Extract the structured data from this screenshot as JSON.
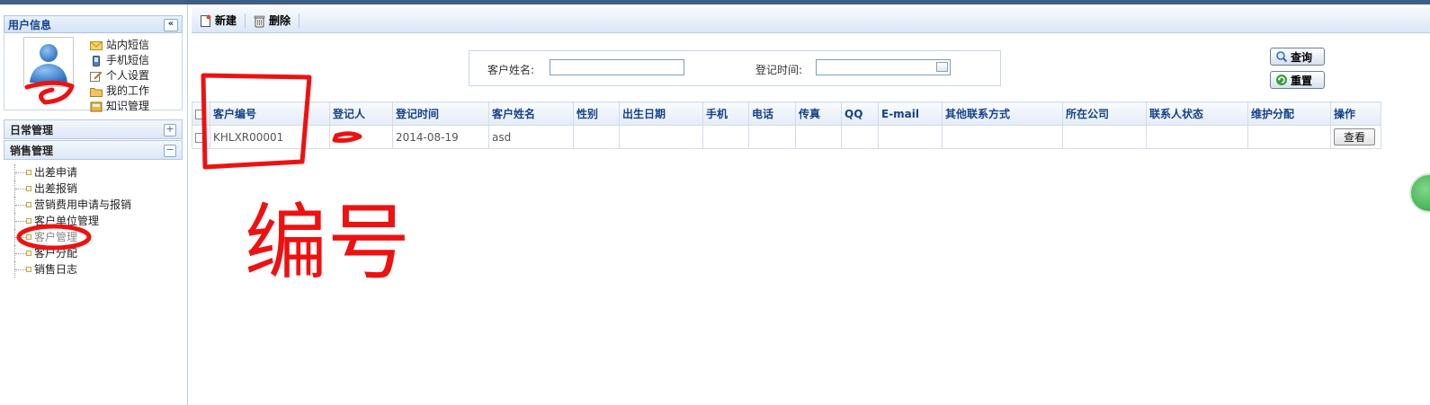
{
  "left": {
    "user_panel_title": "用户信息",
    "collapse_glyph": "«",
    "quick_links": [
      {
        "label": "站内短信",
        "icon": "envelope-icon"
      },
      {
        "label": "手机短信",
        "icon": "mobile-phone-icon"
      },
      {
        "label": "个人设置",
        "icon": "edit-settings-icon"
      },
      {
        "label": "我的工作",
        "icon": "folder-work-icon"
      },
      {
        "label": "知识管理",
        "icon": "knowledge-book-icon"
      }
    ],
    "sections": [
      {
        "label": "日常管理",
        "toggle": "+"
      },
      {
        "label": "销售管理",
        "toggle": "−"
      }
    ],
    "menu_items": [
      "出差申请",
      "出差报销",
      "营销费用申请与报销",
      "客户单位管理",
      "客户管理",
      "客户分配",
      "销售日志"
    ]
  },
  "toolbar": {
    "new_label": "新建",
    "delete_label": "删除"
  },
  "search": {
    "customer_name_label": "客户姓名:",
    "customer_name_value": "",
    "register_time_label": "登记时间:",
    "register_time_value": "",
    "query_label": "查询",
    "reset_label": "重置"
  },
  "table": {
    "headers": [
      "客户编号",
      "登记人",
      "登记时间",
      "客户姓名",
      "性别",
      "出生日期",
      "手机",
      "电话",
      "传真",
      "QQ",
      "E-mail",
      "其他联系方式",
      "所在公司",
      "联系人状态",
      "维护分配",
      "操作"
    ],
    "rows": [
      {
        "cells": [
          "KHLXR00001",
          "",
          "2014-08-19",
          "asd",
          "",
          "",
          "",
          "",
          "",
          "",
          "",
          "",
          "",
          "",
          "",
          ""
        ],
        "action_label": "查看"
      }
    ]
  },
  "annotation": {
    "handwritten_text": "编号"
  },
  "colors": {
    "accent": "#15428b",
    "annotation_red": "#ee1111",
    "topbar": "#3f5e86"
  }
}
